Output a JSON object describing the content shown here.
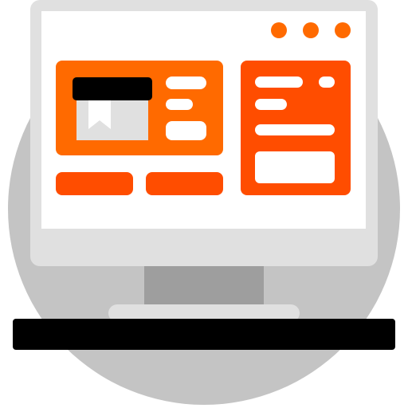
{
  "illustration": {
    "subject": "desktop-monitor-with-web-page-icon",
    "colors": {
      "background_circle": "#c4c4c4",
      "monitor_frame": "#e0e0e0",
      "screen": "#ffffff",
      "stand_neck": "#9e9e9e",
      "desk": "#000000",
      "accent_primary": "#ff6a00",
      "accent_secondary": "#ff4d00",
      "tile_light": "#e0e0e0",
      "placeholder_white": "#ffffff",
      "media_header": "#000000"
    },
    "window_controls": [
      "dot-icon",
      "dot-icon",
      "dot-icon"
    ],
    "icons": [
      "bookmark-icon"
    ]
  }
}
